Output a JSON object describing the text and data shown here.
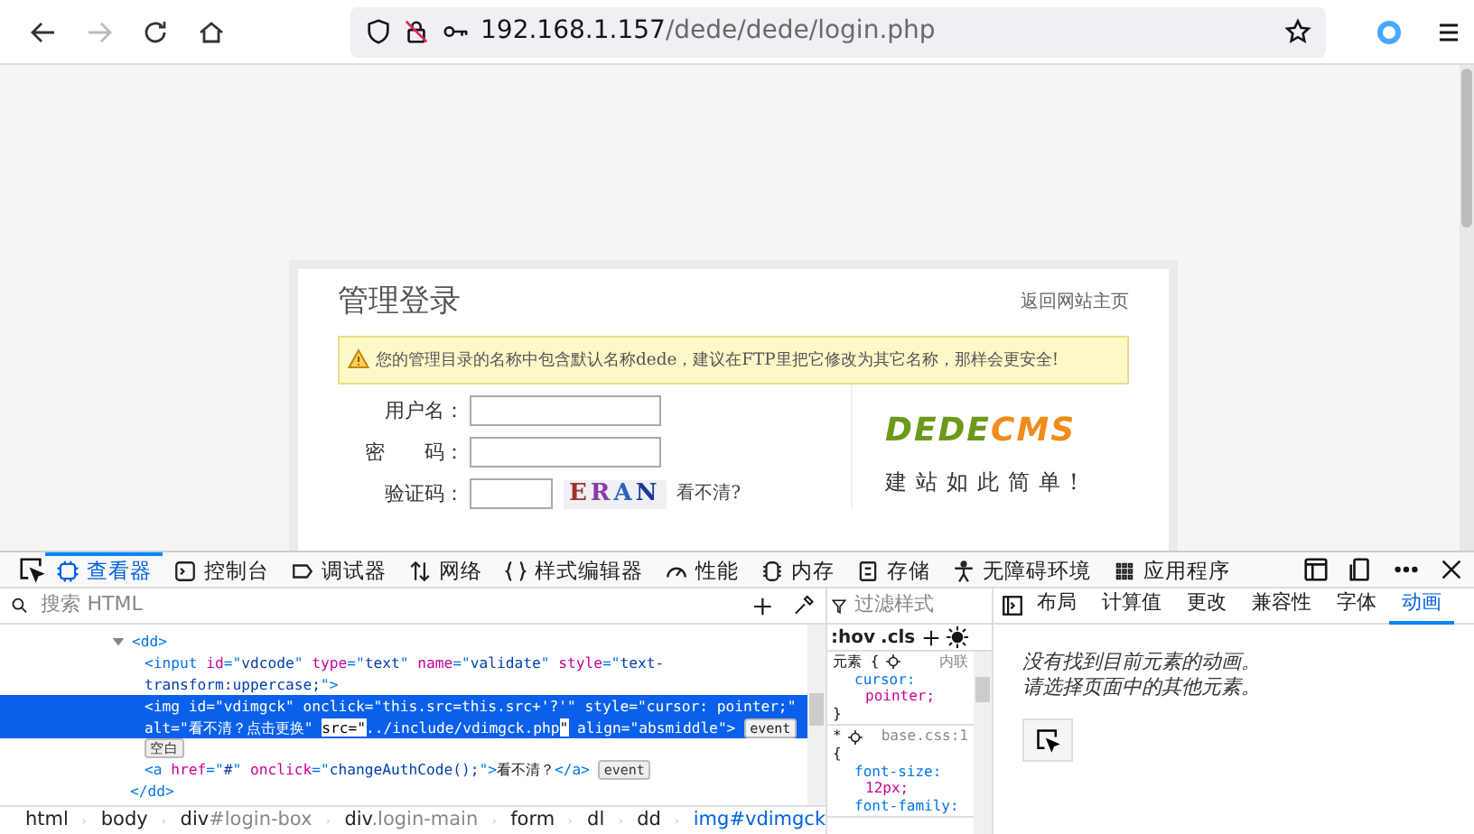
{
  "browser": {
    "nav": [
      {
        "kind": "back",
        "disabled": false
      },
      {
        "kind": "forward",
        "disabled": true
      },
      {
        "kind": "reload",
        "disabled": false
      },
      {
        "kind": "home",
        "disabled": false
      }
    ],
    "url_host": "192.168.1.157",
    "url_path": "/dede/dede/login.php"
  },
  "page": {
    "title": "管理登录",
    "home_link": "返回网站主页",
    "warning": "您的管理目录的名称中包含默认名称dede，建议在FTP里把它修改为其它名称，那样会更安全!",
    "fields": [
      {
        "label": "用户名：",
        "kind": "text"
      },
      {
        "label": "密　　码：",
        "kind": "text"
      },
      {
        "label": "验证码：",
        "kind": "captcha"
      }
    ],
    "captcha": [
      {
        "char": "E",
        "color": "#a0322a"
      },
      {
        "char": "R",
        "color": "#8a3aa8"
      },
      {
        "char": "A",
        "color": "#2a62b8"
      },
      {
        "char": "N",
        "color": "#1a3a9a"
      }
    ],
    "captcha_link": "看不清?",
    "logo": [
      {
        "text": "DEDE",
        "color": "#6b9a1a"
      },
      {
        "text": "CMS",
        "color": "#f08c1a"
      }
    ],
    "slogan": "建站如此简单!"
  },
  "devtools": {
    "tabs": [
      {
        "label": "查看器",
        "selected": true
      },
      {
        "label": "控制台",
        "selected": false
      },
      {
        "label": "调试器",
        "selected": false
      },
      {
        "label": "网络",
        "selected": false
      },
      {
        "label": "样式编辑器",
        "selected": false
      },
      {
        "label": "性能",
        "selected": false
      },
      {
        "label": "内存",
        "selected": false
      },
      {
        "label": "存储",
        "selected": false
      },
      {
        "label": "无障碍环境",
        "selected": false
      },
      {
        "label": "应用程序",
        "selected": false
      }
    ],
    "html_search": {
      "placeholder": "搜索 HTML"
    },
    "html_tree": {
      "open": "<dd>",
      "expanded": true,
      "close": "</dd>",
      "children": [
        {
          "kind": "element",
          "selected": false,
          "tokens": [
            {
              "kind": "tag",
              "text": "<input "
            },
            {
              "kind": "attr",
              "text": "id"
            },
            {
              "kind": "tag",
              "text": "=\""
            },
            {
              "kind": "val",
              "text": "vdcode"
            },
            {
              "kind": "tag",
              "text": "\" "
            },
            {
              "kind": "attr",
              "text": "type"
            },
            {
              "kind": "tag",
              "text": "=\""
            },
            {
              "kind": "val",
              "text": "text"
            },
            {
              "kind": "tag",
              "text": "\" "
            },
            {
              "kind": "attr",
              "text": "name"
            },
            {
              "kind": "tag",
              "text": "=\""
            },
            {
              "kind": "val",
              "text": "validate"
            },
            {
              "kind": "tag",
              "text": "\" "
            },
            {
              "kind": "attr",
              "text": "style"
            },
            {
              "kind": "tag",
              "text": "=\""
            },
            {
              "kind": "val",
              "text": "text-transform:uppercase;"
            },
            {
              "kind": "tag",
              "text": "\">"
            }
          ]
        },
        {
          "kind": "element",
          "selected": true,
          "badge": "event",
          "tokens": [
            {
              "kind": "tag",
              "text": "<img "
            },
            {
              "kind": "attr",
              "text": "id"
            },
            {
              "kind": "tag",
              "text": "=\""
            },
            {
              "kind": "val",
              "text": "vdimgck"
            },
            {
              "kind": "tag",
              "text": "\" "
            },
            {
              "kind": "attr",
              "text": "onclick"
            },
            {
              "kind": "tag",
              "text": "=\""
            },
            {
              "kind": "val",
              "text": "this.src=this.src+'?'"
            },
            {
              "kind": "tag",
              "text": "\" "
            },
            {
              "kind": "attr",
              "text": "style"
            },
            {
              "kind": "tag",
              "text": "=\""
            },
            {
              "kind": "val",
              "text": "cursor: pointer;"
            },
            {
              "kind": "tag",
              "text": "\" "
            },
            {
              "kind": "attr",
              "text": "alt"
            },
            {
              "kind": "tag",
              "text": "=\""
            },
            {
              "kind": "val",
              "text": "看不清？点击更换"
            },
            {
              "kind": "tag",
              "text": "\" "
            },
            {
              "kind": "hl",
              "text": "src=\""
            },
            {
              "kind": "val",
              "text": "../include/vdimgck.php"
            },
            {
              "kind": "hl",
              "text": "\""
            },
            {
              "kind": "attr",
              "text": " align"
            },
            {
              "kind": "tag",
              "text": "=\""
            },
            {
              "kind": "val",
              "text": "absmiddle"
            },
            {
              "kind": "tag",
              "text": "\">"
            }
          ]
        },
        {
          "kind": "whitespace",
          "selected": false,
          "badge": "空白"
        },
        {
          "kind": "element",
          "selected": false,
          "badge": "event",
          "tokens": [
            {
              "kind": "tag",
              "text": "<a "
            },
            {
              "kind": "attr",
              "text": "href"
            },
            {
              "kind": "tag",
              "text": "=\""
            },
            {
              "kind": "val",
              "text": "#"
            },
            {
              "kind": "tag",
              "text": "\" "
            },
            {
              "kind": "attr",
              "text": "onclick"
            },
            {
              "kind": "tag",
              "text": "=\""
            },
            {
              "kind": "val",
              "text": "changeAuthCode();"
            },
            {
              "kind": "tag",
              "text": "\">"
            },
            {
              "kind": "text",
              "text": "看不清？"
            },
            {
              "kind": "tag",
              "text": "</a>"
            }
          ]
        }
      ]
    },
    "breadcrumbs": [
      {
        "tag": "html",
        "selected": false
      },
      {
        "tag": "body",
        "selected": false
      },
      {
        "tag": "div",
        "detail": "#login-box",
        "selected": false
      },
      {
        "tag": "div",
        "detail": ".login-main",
        "selected": false
      },
      {
        "tag": "form",
        "selected": false
      },
      {
        "tag": "dl",
        "selected": false
      },
      {
        "tag": "dd",
        "selected": false
      },
      {
        "tag": "img",
        "detail": "#vdimgck",
        "selected": true
      }
    ],
    "styles_filter": {
      "placeholder": "过滤样式"
    },
    "styles_tools": [
      ":hov",
      ".cls"
    ],
    "rules": [
      {
        "selector": "元素 {",
        "source": "内联",
        "decls": [
          {
            "prop": "cursor:",
            "val": "pointer;"
          }
        ],
        "close": "}"
      },
      {
        "selector": "*",
        "source": "base.css:1",
        "open": "{",
        "decls": [
          {
            "prop": "font-size:",
            "val": "12px;"
          },
          {
            "prop": "font-family:"
          }
        ]
      }
    ],
    "side_tabs": [
      {
        "label": "布局",
        "selected": false
      },
      {
        "label": "计算值",
        "selected": false
      },
      {
        "label": "更改",
        "selected": false
      },
      {
        "label": "兼容性",
        "selected": false
      },
      {
        "label": "字体",
        "selected": false
      },
      {
        "label": "动画",
        "selected": true
      }
    ],
    "animation_message": [
      "没有找到目前元素的动画。",
      "请选择页面中的其他元素。"
    ]
  }
}
